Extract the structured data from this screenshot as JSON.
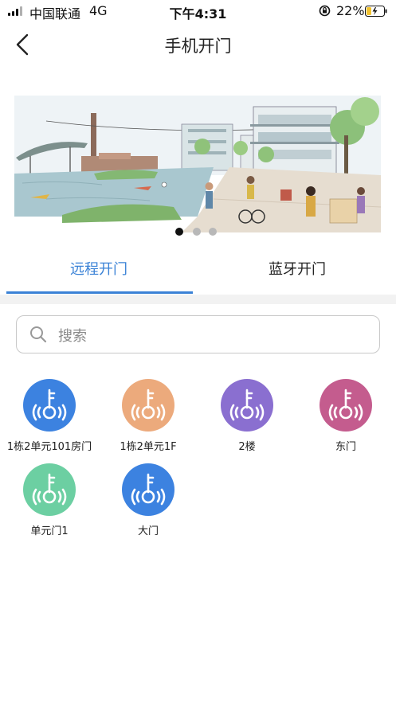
{
  "status_bar": {
    "carrier": "中国联通",
    "network": "4G",
    "time": "下午4:31",
    "battery": "22%"
  },
  "nav": {
    "title": "手机开门",
    "back_icon": "chevron-left-icon"
  },
  "banner": {
    "page_count": 3,
    "active_page": 1
  },
  "tabs": [
    {
      "label": "远程开门",
      "active": true
    },
    {
      "label": "蓝牙开门",
      "active": false
    }
  ],
  "search": {
    "placeholder": "搜索",
    "icon": "search-icon"
  },
  "doors": [
    {
      "label": "1栋2单元101房门",
      "color": "#3c82e0",
      "icon": "key-icon"
    },
    {
      "label": "1栋2单元1F",
      "color": "#ecaa7c",
      "icon": "key-icon"
    },
    {
      "label": "2楼",
      "color": "#8a6fd0",
      "icon": "key-icon"
    },
    {
      "label": "东门",
      "color": "#c45c8e",
      "icon": "key-icon"
    },
    {
      "label": "单元门1",
      "color": "#6ccfa2",
      "icon": "key-icon"
    },
    {
      "label": "大门",
      "color": "#3c82e0",
      "icon": "key-icon"
    }
  ],
  "colors": {
    "accent": "#3a82d6"
  }
}
